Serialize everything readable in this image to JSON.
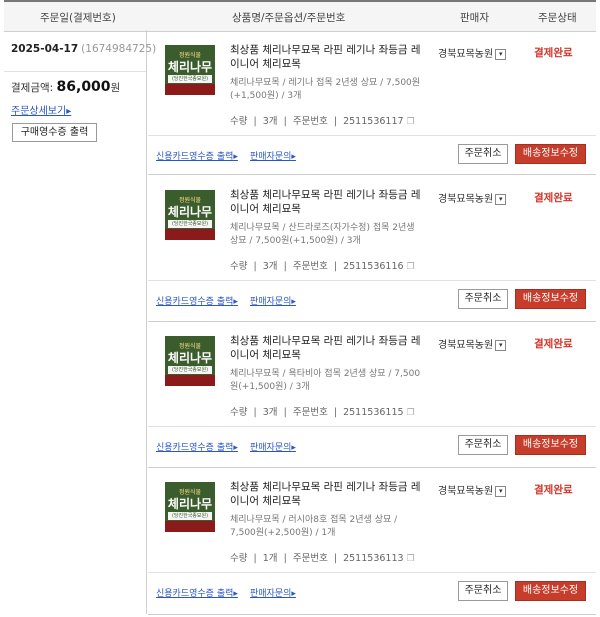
{
  "header": {
    "col_order_date": "주문일(결제번호)",
    "col_product": "상품명/주문옵션/주문번호",
    "col_seller": "판매자",
    "col_status": "주문상태"
  },
  "summary": {
    "date": "2025-04-17",
    "payment_no": "(1674984725)",
    "pay_label": "결제금액: ",
    "pay_amount": "86,000",
    "pay_unit": "원",
    "detail_link": "주문상세보기",
    "receipt_button": "구매영수증 출력"
  },
  "thumb": {
    "top": "정원식물",
    "main": "체리나무",
    "band": "(당진한국종묘원)"
  },
  "orders": [
    {
      "title": "최상품 체리나무묘목 라핀 레기나 좌등금 레이니어 체리묘목",
      "option": "체리나무묘목 / 레기나 접목 2년생 상묘 / 7,500원(+1,500원) / 3개",
      "qty_label": "수량",
      "qty": "3개",
      "ono_label": "주문번호",
      "order_no": "2511536117",
      "seller": "경북묘목농원",
      "status": "결제완료",
      "card_receipt": "신용카드영수증 출력",
      "seller_inquiry": "판매자문의",
      "cancel": "주문취소",
      "ship_edit": "배송정보수정"
    },
    {
      "title": "최상품 체리나무묘목 라핀 레기나 좌등금 레이니어 체리묘목",
      "option": "체리나무묘목 / 산드라로즈(자가수정) 접목 2년생 상묘 / 7,500원(+1,500원) / 3개",
      "qty_label": "수량",
      "qty": "3개",
      "ono_label": "주문번호",
      "order_no": "2511536116",
      "seller": "경북묘목농원",
      "status": "결제완료",
      "card_receipt": "신용카드영수증 출력",
      "seller_inquiry": "판매자문의",
      "cancel": "주문취소",
      "ship_edit": "배송정보수정"
    },
    {
      "title": "최상품 체리나무묘목 라핀 레기나 좌등금 레이니어 체리묘목",
      "option": "체리나무묘목 / 욕타비아 접목 2년생 상묘 / 7,500원(+1,500원) / 3개",
      "qty_label": "수량",
      "qty": "3개",
      "ono_label": "주문번호",
      "order_no": "2511536115",
      "seller": "경북묘목농원",
      "status": "결제완료",
      "card_receipt": "신용카드영수증 출력",
      "seller_inquiry": "판매자문의",
      "cancel": "주문취소",
      "ship_edit": "배송정보수정"
    },
    {
      "title": "최상품 체리나무묘목 라핀 레기나 좌등금 레이니어 체리묘목",
      "option": "체리나무묘목 / 러시아8호 접목 2년생 상묘 / 7,500원(+2,500원) / 1개",
      "qty_label": "수량",
      "qty": "1개",
      "ono_label": "주문번호",
      "order_no": "2511536113",
      "seller": "경북묘목농원",
      "status": "결제완료",
      "card_receipt": "신용카드영수증 출력",
      "seller_inquiry": "판매자문의",
      "cancel": "주문취소",
      "ship_edit": "배송정보수정"
    }
  ]
}
